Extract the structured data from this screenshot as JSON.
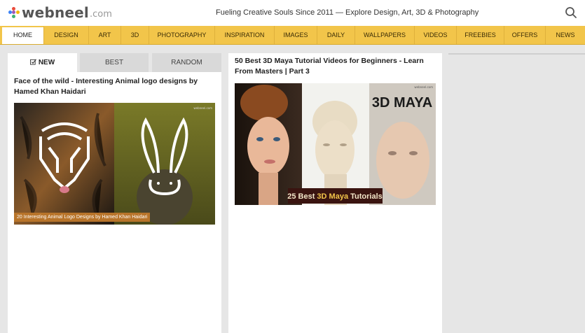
{
  "header": {
    "logo_text": "webneel",
    "logo_suffix": ".com",
    "tagline": "Fueling Creative Souls Since 2011 — Explore Design, Art, 3D & Photography"
  },
  "nav": {
    "items": [
      {
        "label": "HOME"
      },
      {
        "label": "DESIGN"
      },
      {
        "label": "ART"
      },
      {
        "label": "3D"
      },
      {
        "label": "PHOTOGRAPHY"
      },
      {
        "label": "INSPIRATION"
      },
      {
        "label": "IMAGES"
      },
      {
        "label": "DAILY"
      },
      {
        "label": "WALLPAPERS"
      },
      {
        "label": "VIDEOS"
      },
      {
        "label": "FREEBIES"
      },
      {
        "label": "OFFERS"
      },
      {
        "label": "NEWS"
      }
    ]
  },
  "tabs": {
    "new": "NEW",
    "best": "BEST",
    "random": "RANDOM"
  },
  "posts": [
    {
      "title": "Face of the wild - Interesting Animal logo designs by Hamed Khan Haidari",
      "caption": "20 Interesting Animal Logo Designs by Hamed Khan Haidari",
      "watermark": "webneel.com"
    },
    {
      "title": "50 Best 3D Maya Tutorial Videos for Beginners - Learn From Masters | Part 3",
      "caption_a": "25 Best",
      "caption_b": "3D Maya",
      "caption_c": "Tutorials",
      "overlay": "3D MAYA",
      "watermark": "webneel.com"
    }
  ],
  "colors": {
    "nav_bg": "#f2c54a",
    "page_bg": "#e6e6e6"
  }
}
